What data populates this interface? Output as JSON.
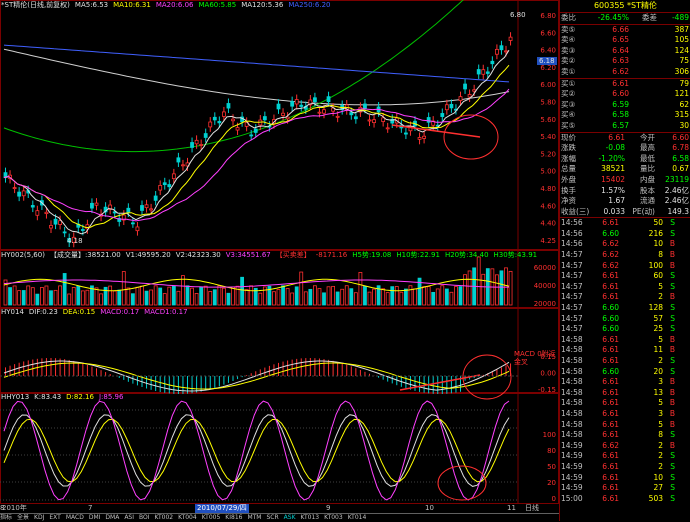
{
  "price_panel": {
    "legend": [
      {
        "text": "*ST精伦(日线,前复权)",
        "color": "#e0e0e0"
      },
      {
        "text": "MA5:6.53",
        "color": "#e0e0e0"
      },
      {
        "text": "MA10:6.31",
        "color": "#ffff00"
      },
      {
        "text": "MA20:6.06",
        "color": "#ff40ff"
      },
      {
        "text": "MA60:5.85",
        "color": "#00ff00"
      },
      {
        "text": "MA120:5.36",
        "color": "#e0e0e0"
      },
      {
        "text": "MA250:6.20",
        "color": "#4060ff"
      }
    ],
    "yaxis": [
      "6.80",
      "6.60",
      "6.40",
      "6.20",
      "6.00",
      "5.80",
      "5.60",
      "5.40",
      "5.20",
      "5.00",
      "4.80",
      "4.60",
      "4.40",
      "4.25"
    ],
    "high_label": "6.80",
    "low_label": "4.18",
    "marker_label": "6.18"
  },
  "volume_panel": {
    "legend": [
      {
        "text": "HY002(5,60)",
        "color": "#e0e0e0"
      },
      {
        "text": "【成交量】:38521.00",
        "color": "#e0e0e0"
      },
      {
        "text": "V1:49595.20",
        "color": "#e0e0e0"
      },
      {
        "text": "V2:42323.30",
        "color": "#e0e0e0"
      },
      {
        "text": "V3:34551.67",
        "color": "#ff40ff"
      },
      {
        "text": "【买卖差】",
        "color": "#ff3030"
      },
      {
        "text": "-8171.16",
        "color": "#ff3030"
      },
      {
        "text": "H5势:19.08",
        "color": "#00ff00"
      },
      {
        "text": "H10势:22.91",
        "color": "#00ff00"
      },
      {
        "text": "H20势:34.40",
        "color": "#00ff00"
      },
      {
        "text": "H30势:43.91",
        "color": "#00ff00"
      }
    ],
    "yaxis": [
      "60000",
      "40000",
      "20000"
    ]
  },
  "macd_panel": {
    "legend": [
      {
        "text": "HY014",
        "color": "#e0e0e0"
      },
      {
        "text": "DIF:0.23",
        "color": "#e0e0e0"
      },
      {
        "text": "DEA:0.15",
        "color": "#ffff00"
      },
      {
        "text": "MACD:0.17",
        "color": "#ff40ff"
      },
      {
        "text": "MACD1:0.17",
        "color": "#ff40ff"
      }
    ],
    "yaxis": [
      "0.15",
      "0.00",
      "-0.15"
    ],
    "annotation": "MACD 0附近金叉"
  },
  "kdj_panel": {
    "legend": [
      {
        "text": "HHY013",
        "color": "#e0e0e0"
      },
      {
        "text": "K:83.43",
        "color": "#e0e0e0"
      },
      {
        "text": "D:82.16",
        "color": "#ffff00"
      },
      {
        "text": "J:85.96",
        "color": "#ff40ff"
      }
    ],
    "yaxis": [
      "100",
      "80",
      "50",
      "20",
      "0"
    ]
  },
  "date_axis": {
    "labels": [
      "2010年",
      "7",
      "2010/07/29/四",
      "8",
      "9",
      "10",
      "11"
    ],
    "right_label": "日线"
  },
  "tabs": [
    "指标",
    "全景",
    "KDJ",
    "EXT",
    "MACD",
    "DMI",
    "DMA",
    "ASI",
    "BOI",
    "KT002",
    "KT004",
    "KT005",
    "KI816",
    "MTM",
    "SCR",
    "ASK",
    "KT013",
    "KT003",
    "KT014"
  ],
  "quote": {
    "header": "600355 *ST精伦",
    "weibi": {
      "label": "委比",
      "value": "-26.45%",
      "label2": "委差",
      "value2": "-489"
    },
    "asks": [
      {
        "label": "卖⑤",
        "price": "6.66",
        "vol": "387"
      },
      {
        "label": "卖④",
        "price": "6.65",
        "vol": "105"
      },
      {
        "label": "卖③",
        "price": "6.64",
        "vol": "124"
      },
      {
        "label": "卖②",
        "price": "6.63",
        "vol": "75"
      },
      {
        "label": "卖①",
        "price": "6.62",
        "vol": "306"
      }
    ],
    "bids": [
      {
        "label": "买①",
        "price": "6.61",
        "vol": "79"
      },
      {
        "label": "买②",
        "price": "6.60",
        "vol": "121"
      },
      {
        "label": "买③",
        "price": "6.59",
        "vol": "62"
      },
      {
        "label": "买④",
        "price": "6.58",
        "vol": "315"
      },
      {
        "label": "买⑤",
        "price": "6.57",
        "vol": "30"
      }
    ],
    "stats": [
      {
        "l1": "现价",
        "v1": "6.61",
        "l2": "今开",
        "v2": "6.60"
      },
      {
        "l1": "涨跌",
        "v1": "-0.08",
        "l2": "最高",
        "v2": "6.78"
      },
      {
        "l1": "涨幅",
        "v1": "-1.20%",
        "l2": "最低",
        "v2": "6.58"
      },
      {
        "l1": "总量",
        "v1": "38521",
        "l2": "量比",
        "v2": "0.67"
      },
      {
        "l1": "外盘",
        "v1": "15402",
        "l2": "内盘",
        "v2": "23119"
      },
      {
        "l1": "换手",
        "v1": "1.57%",
        "l2": "股本",
        "v2": "2.46亿"
      },
      {
        "l1": "净资",
        "v1": "1.67",
        "l2": "流通",
        "v2": "2.46亿"
      },
      {
        "l1": "收益(三)",
        "v1": "0.033",
        "l2": "PE(动)",
        "v2": "149.3"
      }
    ],
    "ticks": [
      {
        "t": "14:56",
        "p": "6.61",
        "v": "50",
        "d": "S"
      },
      {
        "t": "14:56",
        "p": "6.60",
        "v": "216",
        "d": "S"
      },
      {
        "t": "14:56",
        "p": "6.62",
        "v": "10",
        "d": "B"
      },
      {
        "t": "14:57",
        "p": "6.62",
        "v": "8",
        "d": "B"
      },
      {
        "t": "14:57",
        "p": "6.62",
        "v": "100",
        "d": "B"
      },
      {
        "t": "14:57",
        "p": "6.61",
        "v": "60",
        "d": "S"
      },
      {
        "t": "14:57",
        "p": "6.61",
        "v": "5",
        "d": "S"
      },
      {
        "t": "14:57",
        "p": "6.61",
        "v": "2",
        "d": "B"
      },
      {
        "t": "14:57",
        "p": "6.60",
        "v": "128",
        "d": "S"
      },
      {
        "t": "14:57",
        "p": "6.60",
        "v": "57",
        "d": "S"
      },
      {
        "t": "14:57",
        "p": "6.60",
        "v": "25",
        "d": "S"
      },
      {
        "t": "14:58",
        "p": "6.61",
        "v": "5",
        "d": "B"
      },
      {
        "t": "14:58",
        "p": "6.61",
        "v": "11",
        "d": "B"
      },
      {
        "t": "14:58",
        "p": "6.61",
        "v": "2",
        "d": "S"
      },
      {
        "t": "14:58",
        "p": "6.60",
        "v": "20",
        "d": "S"
      },
      {
        "t": "14:58",
        "p": "6.61",
        "v": "3",
        "d": "B"
      },
      {
        "t": "14:58",
        "p": "6.61",
        "v": "13",
        "d": "B"
      },
      {
        "t": "14:58",
        "p": "6.61",
        "v": "5",
        "d": "B"
      },
      {
        "t": "14:58",
        "p": "6.61",
        "v": "3",
        "d": "B"
      },
      {
        "t": "14:58",
        "p": "6.61",
        "v": "5",
        "d": "B"
      },
      {
        "t": "14:58",
        "p": "6.61",
        "v": "8",
        "d": "S"
      },
      {
        "t": "14:59",
        "p": "6.62",
        "v": "2",
        "d": "B"
      },
      {
        "t": "14:59",
        "p": "6.61",
        "v": "2",
        "d": "S"
      },
      {
        "t": "14:59",
        "p": "6.61",
        "v": "2",
        "d": "S"
      },
      {
        "t": "14:59",
        "p": "6.61",
        "v": "10",
        "d": "S"
      },
      {
        "t": "14:59",
        "p": "6.61",
        "v": "27",
        "d": "S"
      },
      {
        "t": "15:00",
        "p": "6.61",
        "v": "503",
        "d": "S"
      }
    ]
  }
}
